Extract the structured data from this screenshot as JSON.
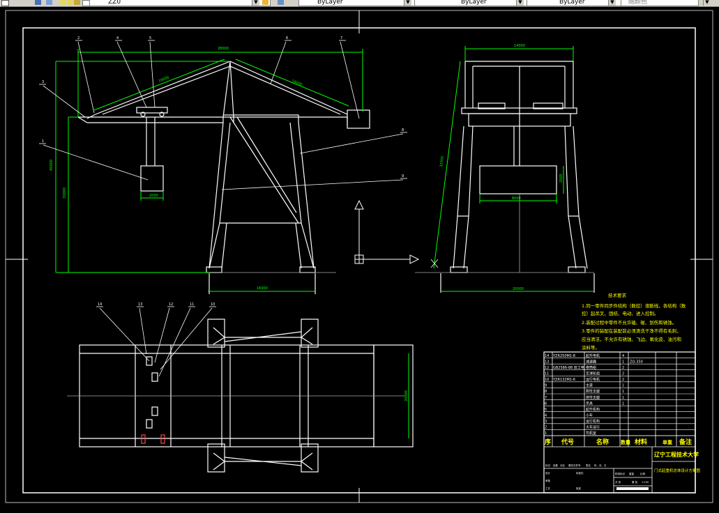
{
  "toolbar": {
    "layer_name": "ZZ0",
    "color_control": "ByLayer",
    "linetype_control": "ByLayer",
    "lineweight_control": "ByLayer",
    "plotstyle_control": "随颜色"
  },
  "tech_requirements": {
    "title": "技术要求",
    "lines": [
      "1.同一零件同步件结构（数控）液断线，各结构（数",
      "  控）起吊叉、固结、电动、进入控制。",
      "2.装配过程中零件不允许磕、碰、划伤和锈蚀。",
      "3.零件的装配在装配前必须清洗干净不得有毛刺，",
      "  应当清洁，不允许有锈蚀、飞边、氧化皮、油污和",
      "  涂料等。"
    ]
  },
  "title_block": {
    "school": "辽宁工程技术大学",
    "drawing_title": "门式起重机总体设计方案图",
    "header": [
      "序",
      "代号",
      "名称",
      "数量",
      "材料",
      "单重",
      "备注"
    ],
    "rows": [
      {
        "no": "14",
        "code": "YZR250M1-8",
        "name": "起升电机",
        "qty": "4",
        "note": ""
      },
      {
        "no": "13",
        "code": "",
        "name": "减速器",
        "qty": "1",
        "note": "ZQ-350"
      },
      {
        "no": "12",
        "code": "GB2586-88 双工电",
        "name": "卷筒组",
        "qty": "2",
        "note": ""
      },
      {
        "no": "11",
        "code": "",
        "name": "定滑轮组",
        "qty": "2",
        "note": ""
      },
      {
        "no": "10",
        "code": "YZR132M1-6",
        "name": "运行电机",
        "qty": "2",
        "note": ""
      },
      {
        "no": "9",
        "code": "",
        "name": "主梁",
        "qty": "1",
        "note": ""
      },
      {
        "no": "8",
        "code": "",
        "name": "刚性支腿",
        "qty": "1",
        "note": ""
      },
      {
        "no": "7",
        "code": "",
        "name": "挠性支腿",
        "qty": "1",
        "note": ""
      },
      {
        "no": "6",
        "code": "",
        "name": "吊具",
        "qty": "1",
        "note": ""
      },
      {
        "no": "5",
        "code": "",
        "name": "起升机构",
        "qty": "",
        "note": ""
      },
      {
        "no": "4",
        "code": "",
        "name": "小车",
        "qty": "",
        "note": ""
      },
      {
        "no": "3",
        "code": "",
        "name": "运行机构",
        "qty": "",
        "note": ""
      },
      {
        "no": "2",
        "code": "",
        "name": "大车运行",
        "qty": "",
        "note": ""
      },
      {
        "no": "1",
        "code": "",
        "name": "司机室",
        "qty": "",
        "note": ""
      }
    ],
    "small_labels": [
      "标记",
      "处数",
      "分区",
      "更改文件号",
      "签名",
      "年、月、日",
      "设计",
      "标准化",
      "审核",
      "工艺",
      "批准",
      "阶段标记",
      "重量",
      "比例",
      "共 张",
      "第 张"
    ],
    "scale": "1:100"
  },
  "part_callouts": [
    "2",
    "4",
    "5",
    "6",
    "7",
    "3",
    "1",
    "8",
    "9",
    "14",
    "13",
    "12",
    "11",
    "10"
  ],
  "dimensions": {
    "span_top": "28000",
    "height_left": "45000",
    "height_inner": "33000",
    "hook_width": "2000",
    "base_width": "16000",
    "side_top": "14000",
    "side_height": "32000",
    "side_load": "2000",
    "side_base": "20000",
    "side_inner": "8000",
    "plan_width": "20000",
    "slope_left": "16000",
    "slope_right": "16000"
  }
}
